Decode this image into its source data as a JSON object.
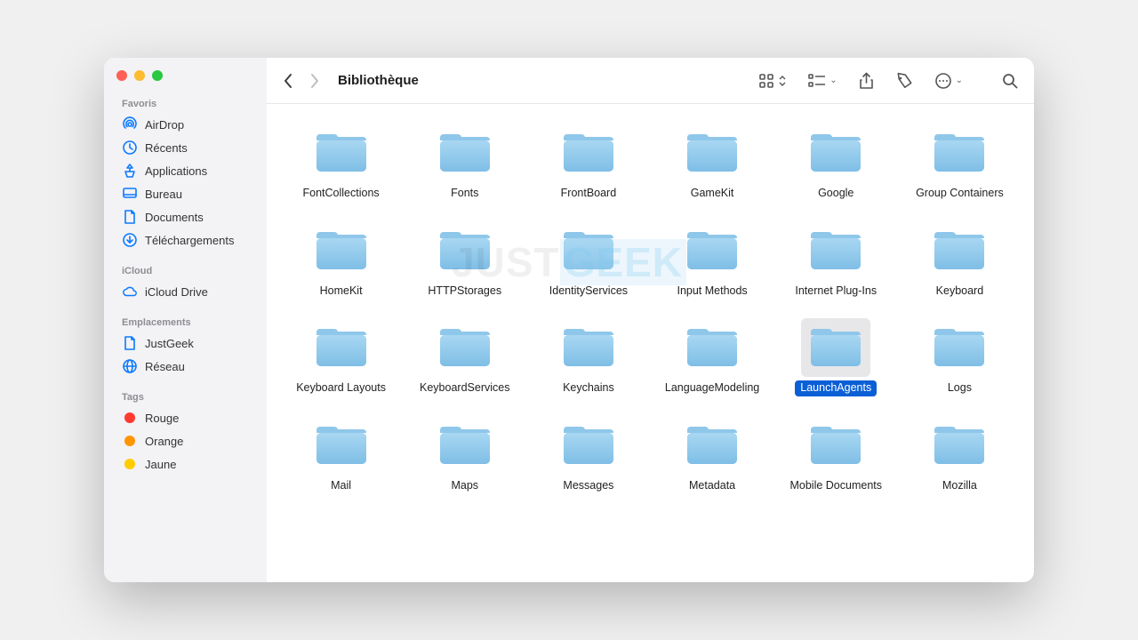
{
  "window": {
    "title": "Bibliothèque"
  },
  "watermark": {
    "part1": "JUST",
    "part2": "GEEK"
  },
  "sidebar": {
    "sections": [
      {
        "label": "Favoris",
        "items": [
          {
            "icon": "airdrop",
            "label": "AirDrop"
          },
          {
            "icon": "recents",
            "label": "Récents"
          },
          {
            "icon": "apps",
            "label": "Applications"
          },
          {
            "icon": "desktop",
            "label": "Bureau"
          },
          {
            "icon": "doc",
            "label": "Documents"
          },
          {
            "icon": "downloads",
            "label": "Téléchargements"
          }
        ]
      },
      {
        "label": "iCloud",
        "items": [
          {
            "icon": "cloud",
            "label": "iCloud Drive"
          }
        ]
      },
      {
        "label": "Emplacements",
        "items": [
          {
            "icon": "doc",
            "label": "JustGeek"
          },
          {
            "icon": "globe",
            "label": "Réseau"
          }
        ]
      },
      {
        "label": "Tags",
        "items": [
          {
            "icon": "tag",
            "color": "#ff3b30",
            "label": "Rouge"
          },
          {
            "icon": "tag",
            "color": "#ff9500",
            "label": "Orange"
          },
          {
            "icon": "tag",
            "color": "#ffcc00",
            "label": "Jaune"
          }
        ]
      }
    ]
  },
  "folders": [
    {
      "name": "FontCollections"
    },
    {
      "name": "Fonts"
    },
    {
      "name": "FrontBoard"
    },
    {
      "name": "GameKit"
    },
    {
      "name": "Google"
    },
    {
      "name": "Group Containers"
    },
    {
      "name": "HomeKit"
    },
    {
      "name": "HTTPStorages"
    },
    {
      "name": "IdentityServices"
    },
    {
      "name": "Input Methods"
    },
    {
      "name": "Internet Plug-Ins"
    },
    {
      "name": "Keyboard"
    },
    {
      "name": "Keyboard Layouts"
    },
    {
      "name": "KeyboardServices"
    },
    {
      "name": "Keychains"
    },
    {
      "name": "LanguageModeling"
    },
    {
      "name": "LaunchAgents",
      "selected": true
    },
    {
      "name": "Logs"
    },
    {
      "name": "Mail"
    },
    {
      "name": "Maps"
    },
    {
      "name": "Messages"
    },
    {
      "name": "Metadata"
    },
    {
      "name": "Mobile Documents"
    },
    {
      "name": "Mozilla"
    }
  ]
}
